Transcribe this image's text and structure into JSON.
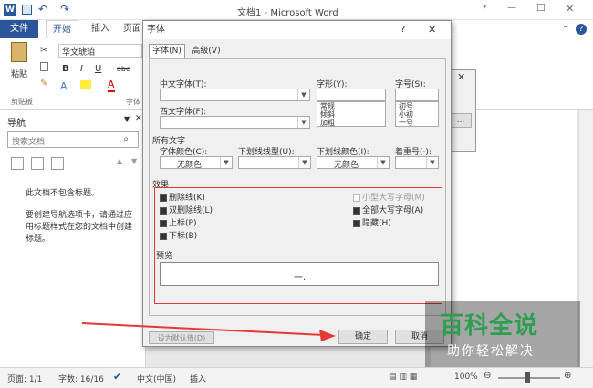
{
  "window": {
    "title": "文档1 - Microsoft Word",
    "help": "?",
    "min": "—",
    "max": "☐",
    "close": "✕"
  },
  "qat": {
    "undo": "↶",
    "redo": "↷"
  },
  "ribbon": {
    "tabs": [
      "文件",
      "开始",
      "插入",
      "页面"
    ],
    "paste_label": "粘贴",
    "clipboard_label": "剪贴板",
    "font_name": "华文琥珀",
    "font_group_label": "字体",
    "bold": "B",
    "italic": "I",
    "underline": "U",
    "strike": "abc",
    "sub": "x₂",
    "font_color_a": "A",
    "right_btn": "..."
  },
  "nav": {
    "title": "导航",
    "search_placeholder": "搜索文档",
    "no_headings": "此文档不包含标题。",
    "hint": "要创建导航选项卡，请通过应用标题样式在您的文档中创建标题。"
  },
  "status": {
    "page": "页面: 1/1",
    "words": "字数: 16/16",
    "lang": "中文(中国)",
    "mode": "插入",
    "zoom": "100%"
  },
  "dialog": {
    "title": "字体",
    "help": "?",
    "close": "✕",
    "tabs": [
      "字体(N)",
      "高级(V)"
    ],
    "cn_font_label": "中文字体(T):",
    "west_font_label": "西文字体(F):",
    "style_label": "字形(Y):",
    "style_options": [
      "常规",
      "倾斜",
      "加粗"
    ],
    "size_label": "字号(S):",
    "size_options": [
      "初号",
      "小初",
      "一号"
    ],
    "all_text_label": "所有文字",
    "font_color_label": "字体颜色(C):",
    "font_color_value": "无颜色",
    "underline_type_label": "下划线线型(U):",
    "underline_color_label": "下划线颜色(I):",
    "underline_color_value": "无颜色",
    "emphasis_label": "着重号(·):",
    "effects_label": "效果",
    "effects": {
      "strike": "删除线(K)",
      "double_strike": "双删除线(L)",
      "superscript": "上标(P)",
      "subscript": "下标(B)",
      "small_caps": "小型大写字母(M)",
      "all_caps": "全部大写字母(A)",
      "hidden": "隐藏(H)"
    },
    "preview_label": "预览",
    "preview_text": "一.",
    "default_btn": "设为默认值(D)",
    "ok": "确定",
    "cancel": "取消"
  },
  "watermark": {
    "title": "百科全说",
    "subtitle": "助你轻松解决"
  }
}
